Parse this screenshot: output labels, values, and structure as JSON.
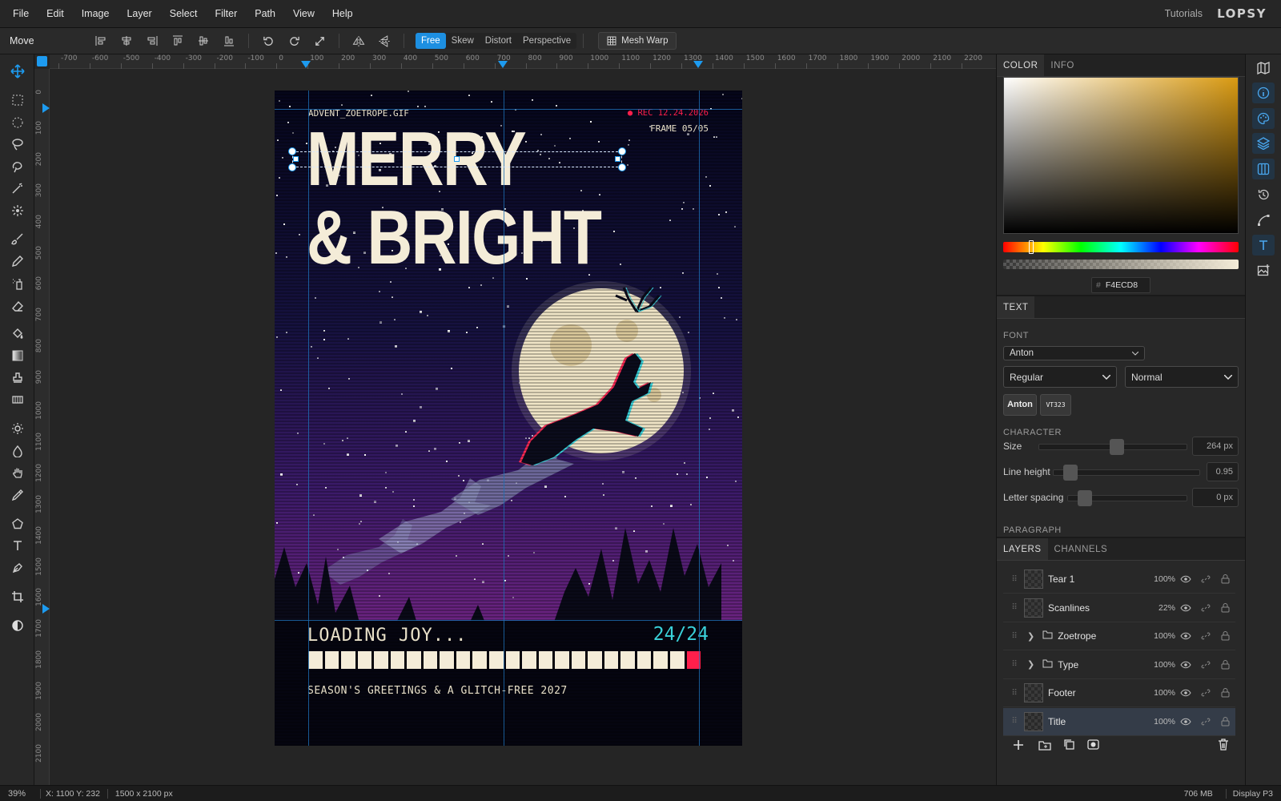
{
  "menu": {
    "items": [
      "File",
      "Edit",
      "Image",
      "Layer",
      "Select",
      "Filter",
      "Path",
      "View",
      "Help"
    ],
    "tutorials": "Tutorials",
    "logo": "LOPSY"
  },
  "options": {
    "tool_name": "Move",
    "modes": [
      "Free",
      "Skew",
      "Distort",
      "Perspective"
    ],
    "active_mode": "Free",
    "mesh_warp": "Mesh Warp"
  },
  "ruler": {
    "x_ticks": [
      "-700",
      "-600",
      "-500",
      "-400",
      "-300",
      "-200",
      "-100",
      "0",
      "100",
      "200",
      "300",
      "400",
      "500",
      "600",
      "700",
      "800",
      "900",
      "1000",
      "1100",
      "1200",
      "1300",
      "1400",
      "1500",
      "1600",
      "1700",
      "1800",
      "1900",
      "2000",
      "2100",
      "2200"
    ],
    "y_ticks": [
      "0",
      "100",
      "200",
      "300",
      "400",
      "500",
      "600",
      "700",
      "800",
      "900",
      "1000",
      "1100",
      "1200",
      "1300",
      "1400",
      "1500",
      "1600",
      "1700",
      "1800",
      "1900",
      "2000",
      "2100"
    ]
  },
  "artwork": {
    "filename": "ADVENT_ZOETROPE.GIF",
    "rec": "● REC 12.24.2026",
    "frame": "FRAME 05/05",
    "title_line1": "MERRY",
    "title_line2": "& BRIGHT",
    "loading": "LOADING JOY...",
    "counter": "24/24",
    "progress_filled": 23,
    "progress_total": 24,
    "greeting": "SEASON'S GREETINGS & A GLITCH-FREE 2027"
  },
  "color_panel": {
    "tabs": [
      "COLOR",
      "INFO"
    ],
    "hex_prefix": "#",
    "hex": "F4ECD8"
  },
  "text_panel": {
    "tab": "TEXT",
    "font_label": "FONT",
    "font": "Anton",
    "style": "Regular",
    "variant": "Normal",
    "chips": [
      "Anton",
      "VT323"
    ],
    "character_label": "CHARACTER",
    "size_label": "Size",
    "size_value": "264 px",
    "line_height_label": "Line height",
    "line_height_value": "0.95",
    "letter_spacing_label": "Letter spacing",
    "letter_spacing_value": "0 px",
    "paragraph_label": "PARAGRAPH"
  },
  "layers_panel": {
    "tabs": [
      "LAYERS",
      "CHANNELS"
    ],
    "layers": [
      {
        "name": "Tear 1",
        "opacity": "100%"
      },
      {
        "name": "Scanlines",
        "opacity": "22%"
      },
      {
        "name": "Zoetrope",
        "opacity": "100%"
      },
      {
        "name": "Type",
        "opacity": "100%"
      },
      {
        "name": "Footer",
        "opacity": "100%"
      },
      {
        "name": "Title",
        "opacity": "100%"
      }
    ]
  },
  "status": {
    "zoom": "39%",
    "coords": "X: 1100 Y: 232",
    "doc_size": "1500 x 2100 px",
    "memory": "706 MB",
    "profile": "Display P3"
  },
  "colors": {
    "accent": "#1d9bf0",
    "cream": "#f4ecd8",
    "rec_red": "#ff1f4b",
    "cyan": "#3ad1d9"
  }
}
